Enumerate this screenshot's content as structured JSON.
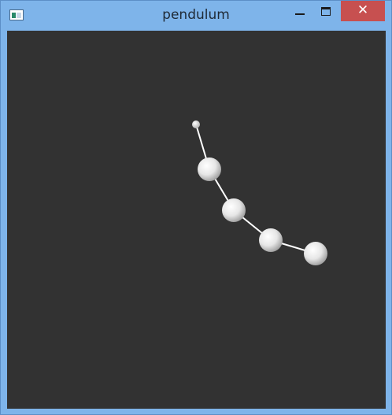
{
  "window": {
    "title": "pendulum",
    "close_glyph": "✕",
    "icons": {
      "app": "app-window-icon",
      "minimize": "minimize-icon",
      "maximize": "maximize-icon",
      "close": "close-icon"
    }
  },
  "scene": {
    "background_color": "#323232",
    "ball_color": "#ffffff",
    "rod_color": "#ffffff",
    "pivot": "pivot",
    "bobs": [
      "bob-1",
      "bob-2",
      "bob-3",
      "bob-4"
    ]
  }
}
